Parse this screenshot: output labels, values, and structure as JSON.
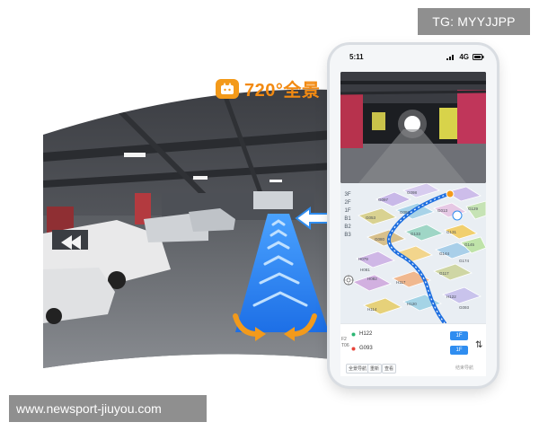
{
  "watermark_top": "TG: MYYJJPP",
  "watermark_bottom": "www.newsport-jiuyou.com",
  "badge": {
    "text": "720°全景",
    "icon": "camera-face-icon"
  },
  "phone": {
    "status": {
      "time": "5:11",
      "signal": "4G"
    },
    "floors": [
      "3F",
      "2F",
      "1F",
      "B1",
      "B2",
      "B3"
    ],
    "map_labels": [
      "G097",
      "G098",
      "G053",
      "G092",
      "G013",
      "G080",
      "G133",
      "G131",
      "G129",
      "G145",
      "G144",
      "G174",
      "G117",
      "H079",
      "H081",
      "H082",
      "H117",
      "H120",
      "H114",
      "H122",
      "G093"
    ],
    "nav_panel": {
      "from_label": "H122",
      "to_label": "G093",
      "from_floor": "1F",
      "to_floor": "1F",
      "side_labels": [
        "F2",
        "T06"
      ],
      "chips": [
        "全景导航",
        "重新",
        "查看"
      ],
      "end_label": "结束导航"
    }
  },
  "colors": {
    "accent": "#2f8df0",
    "badge": "#f28a12",
    "route": "#1f6fe0"
  }
}
